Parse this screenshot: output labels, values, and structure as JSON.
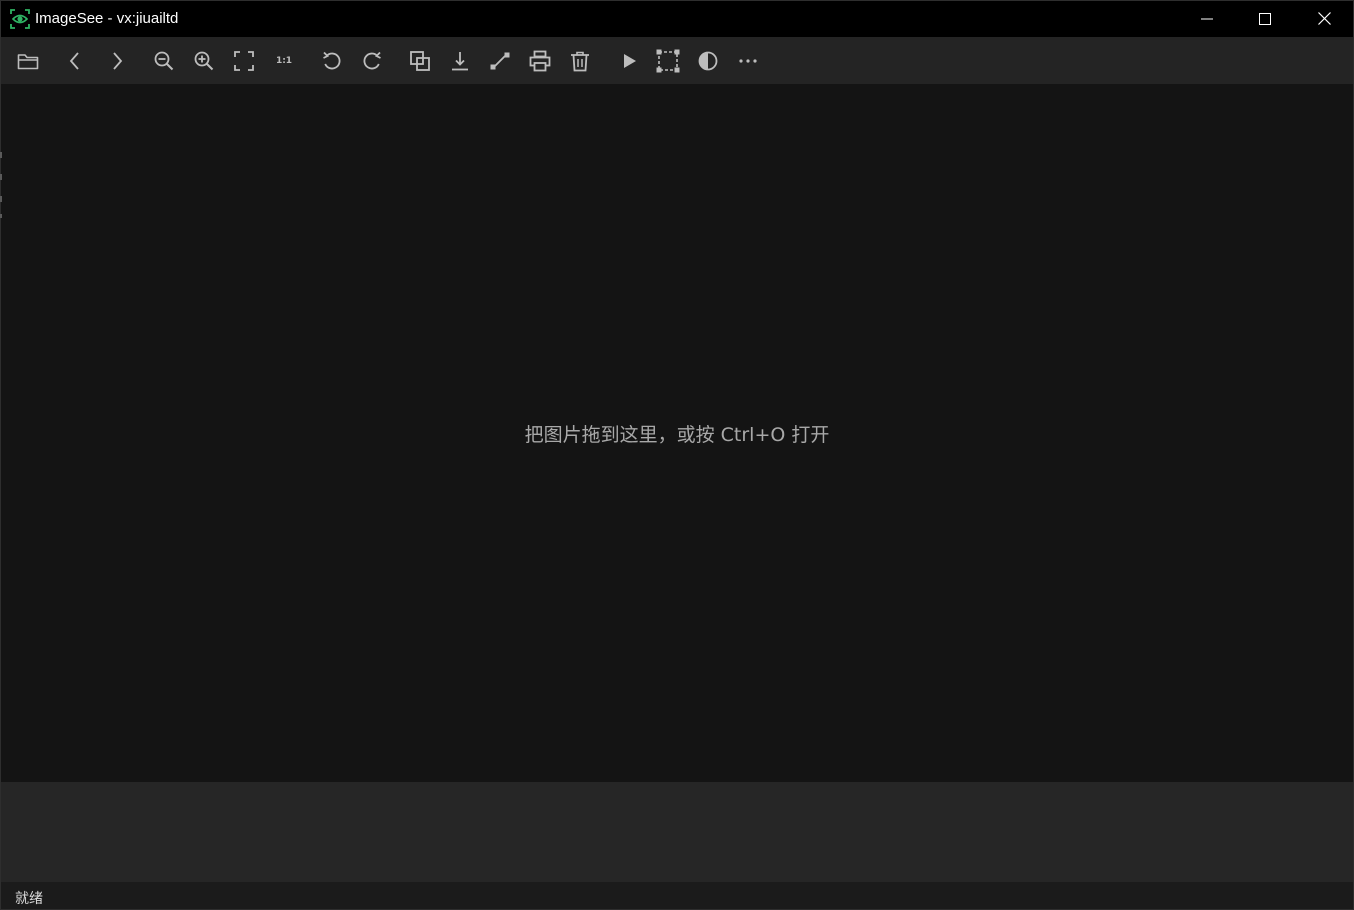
{
  "window": {
    "title": "ImageSee - vx:jiuailtd",
    "app_icon": "eye-icon",
    "controls": {
      "minimize_icon": "minimize-icon",
      "maximize_icon": "maximize-icon",
      "close_icon": "close-icon"
    }
  },
  "toolbar": {
    "items": [
      {
        "name": "open-folder-button",
        "icon": "folder-icon"
      },
      {
        "name": "previous-button",
        "icon": "chevron-left-icon"
      },
      {
        "name": "next-button",
        "icon": "chevron-right-icon"
      },
      {
        "name": "zoom-out-button",
        "icon": "zoom-out-icon"
      },
      {
        "name": "zoom-in-button",
        "icon": "zoom-in-icon"
      },
      {
        "name": "fit-to-window-button",
        "icon": "fit-screen-icon"
      },
      {
        "name": "actual-size-button",
        "icon": "actual-size-icon",
        "label": "1:1"
      },
      {
        "name": "rotate-left-button",
        "icon": "rotate-ccw-icon"
      },
      {
        "name": "rotate-right-button",
        "icon": "rotate-cw-icon"
      },
      {
        "name": "copy-button",
        "icon": "copy-icon"
      },
      {
        "name": "save-button",
        "icon": "download-icon"
      },
      {
        "name": "resize-button",
        "icon": "resize-icon"
      },
      {
        "name": "print-button",
        "icon": "printer-icon"
      },
      {
        "name": "delete-button",
        "icon": "trash-icon"
      },
      {
        "name": "slideshow-button",
        "icon": "play-icon"
      },
      {
        "name": "crop-button",
        "icon": "crop-icon"
      },
      {
        "name": "contrast-button",
        "icon": "contrast-icon"
      },
      {
        "name": "more-button",
        "icon": "more-horizontal-icon"
      }
    ]
  },
  "canvas": {
    "hint": "把图片拖到这里，或按 Ctrl+O 打开"
  },
  "status": {
    "text": "就绪"
  },
  "colors": {
    "accent": "#2fb463",
    "titlebar_bg": "#000000",
    "toolbar_bg": "#242424",
    "canvas_bg": "#141414",
    "thumb_strip_bg": "#262626",
    "icon_color": "#bdbdbd"
  }
}
